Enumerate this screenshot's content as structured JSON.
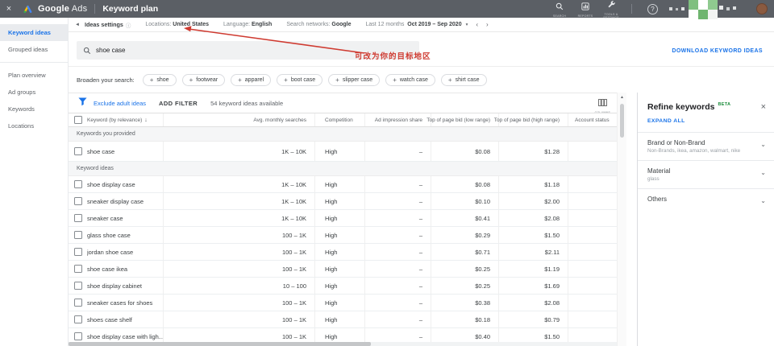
{
  "topbar": {
    "close": "×",
    "brand_google": "Google",
    "brand_ads": "Ads",
    "title": "Keyword plan",
    "nav": [
      {
        "label": "SEARCH"
      },
      {
        "label": "REPORTS"
      },
      {
        "label": "TOOLS & SETTINGS"
      }
    ],
    "help": "?"
  },
  "sidebar": {
    "items": [
      {
        "label": "Keyword ideas"
      },
      {
        "label": "Grouped ideas"
      },
      {
        "label": "Plan overview"
      },
      {
        "label": "Ad groups"
      },
      {
        "label": "Keywords"
      },
      {
        "label": "Locations"
      }
    ]
  },
  "settings_bar": {
    "name": "Ideas settings",
    "locations_label": "Locations:",
    "locations_value": "United States",
    "language_label": "Language:",
    "language_value": "English",
    "networks_label": "Search networks:",
    "networks_value": "Google",
    "range_label": "Last 12 months",
    "range_value": "Oct 2019 – Sep 2020"
  },
  "search": {
    "query": "shoe case"
  },
  "annotation": {
    "text": "可改为你的目标地区"
  },
  "download_label": "DOWNLOAD KEYWORD IDEAS",
  "broaden": {
    "label": "Broaden your search:",
    "chips": [
      {
        "label": "shoe"
      },
      {
        "label": "footwear"
      },
      {
        "label": "apparel"
      },
      {
        "label": "boot case"
      },
      {
        "label": "slipper case"
      },
      {
        "label": "watch case"
      },
      {
        "label": "shirt case"
      }
    ]
  },
  "filter_bar": {
    "exclude": "Exclude adult ideas",
    "add_filter": "ADD FILTER",
    "count": "54 keyword ideas available",
    "columns_label": "COLUMNS"
  },
  "table": {
    "headers": [
      "Keyword (by relevance)",
      "Avg. monthly searches",
      "Competition",
      "Ad impression share",
      "Top of page bid (low range)",
      "Top of page bid (high range)",
      "Account status"
    ],
    "section_provided": "Keywords you provided",
    "section_ideas": "Keyword ideas",
    "provided_rows": [
      {
        "kw": "shoe case",
        "avg": "1K – 10K",
        "comp": "High",
        "imp": "–",
        "low": "$0.08",
        "high": "$1.28"
      }
    ],
    "idea_rows": [
      {
        "kw": "shoe display case",
        "avg": "1K – 10K",
        "comp": "High",
        "imp": "–",
        "low": "$0.08",
        "high": "$1.18"
      },
      {
        "kw": "sneaker display case",
        "avg": "1K – 10K",
        "comp": "High",
        "imp": "–",
        "low": "$0.10",
        "high": "$2.00"
      },
      {
        "kw": "sneaker case",
        "avg": "1K – 10K",
        "comp": "High",
        "imp": "–",
        "low": "$0.41",
        "high": "$2.08"
      },
      {
        "kw": "glass shoe case",
        "avg": "100 – 1K",
        "comp": "High",
        "imp": "–",
        "low": "$0.29",
        "high": "$1.50"
      },
      {
        "kw": "jordan shoe case",
        "avg": "100 – 1K",
        "comp": "High",
        "imp": "–",
        "low": "$0.71",
        "high": "$2.11"
      },
      {
        "kw": "shoe case ikea",
        "avg": "100 – 1K",
        "comp": "High",
        "imp": "–",
        "low": "$0.25",
        "high": "$1.19"
      },
      {
        "kw": "shoe display cabinet",
        "avg": "10 – 100",
        "comp": "High",
        "imp": "–",
        "low": "$0.25",
        "high": "$1.69"
      },
      {
        "kw": "sneaker cases for shoes",
        "avg": "100 – 1K",
        "comp": "High",
        "imp": "–",
        "low": "$0.38",
        "high": "$2.08"
      },
      {
        "kw": "shoes case shelf",
        "avg": "100 – 1K",
        "comp": "High",
        "imp": "–",
        "low": "$0.18",
        "high": "$0.79"
      },
      {
        "kw": "shoe display case with ligh...",
        "avg": "100 – 1K",
        "comp": "High",
        "imp": "–",
        "low": "$0.40",
        "high": "$1.50"
      }
    ]
  },
  "refine": {
    "title": "Refine keywords",
    "beta": "BETA",
    "close": "×",
    "expand_all": "EXPAND ALL",
    "sections": [
      {
        "title": "Brand or Non-Brand",
        "subtitle": "Non-Brands, ikea, amazon, walmart, nike"
      },
      {
        "title": "Material",
        "subtitle": "glass"
      },
      {
        "title": "Others",
        "subtitle": ""
      }
    ]
  },
  "glyphs": {
    "back": "◄",
    "info": "ⓘ",
    "dropdown": "▾",
    "prev": "‹",
    "next": "›",
    "sort_down": "↓",
    "chevron": "⌄",
    "scroll_up": "▲"
  },
  "colors": {
    "accent": "#1a73e8",
    "annotation_red": "#cf3b31",
    "beta_green": "#1e8e3e"
  }
}
